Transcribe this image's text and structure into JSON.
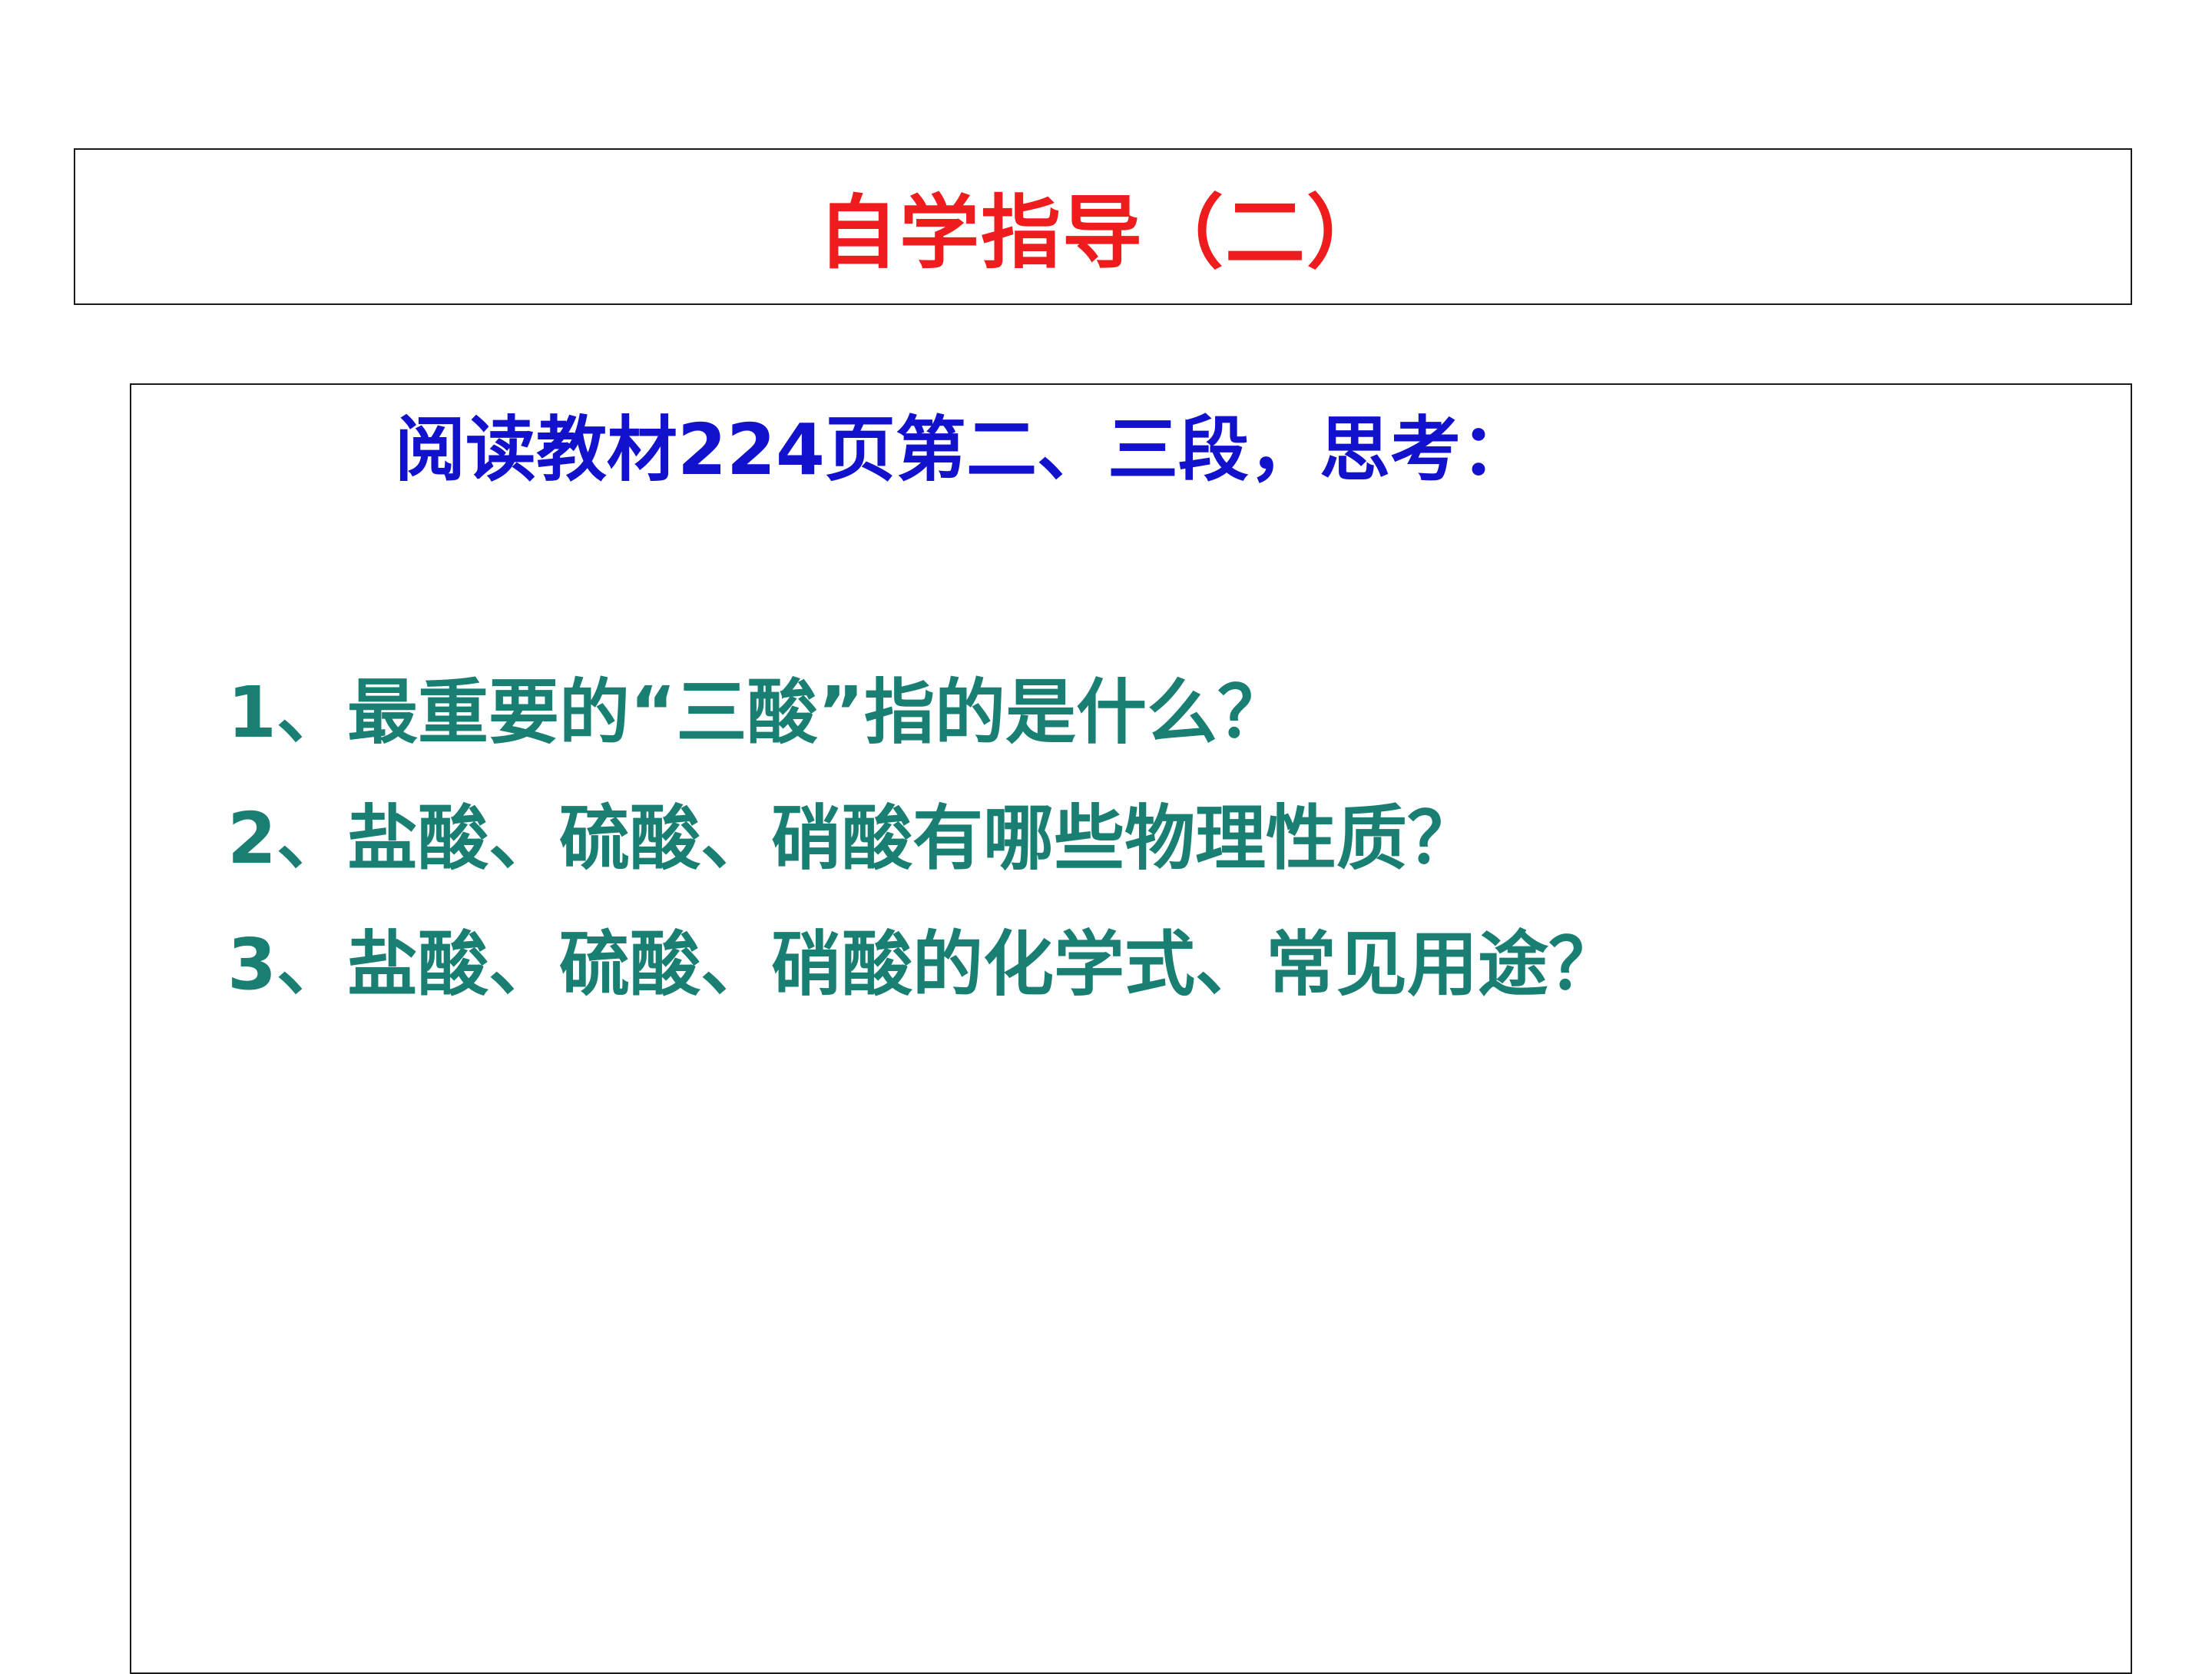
{
  "slide": {
    "title": "自学指导（二）",
    "subtitle": "阅读教材224页第二、三段，思考：",
    "questions": [
      "1、最重要的“三酸”指的是什么？",
      "2、盐酸、硫酸、硝酸有哪些物理性质？",
      "3、盐酸、硫酸、硝酸的化学式、常见用途？"
    ]
  },
  "colors": {
    "title": "#ee1c1c",
    "subtitle": "#1212cc",
    "questions": "#1a7f73",
    "border": "#1a1a1a",
    "background": "#ffffff"
  }
}
